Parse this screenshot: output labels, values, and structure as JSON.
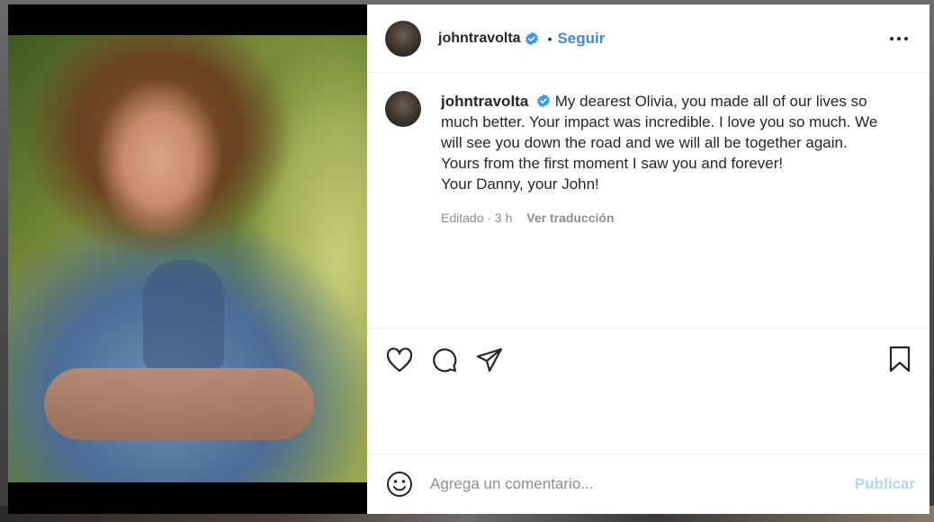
{
  "post": {
    "username": "johntravolta",
    "dot": "•",
    "follow_label": "Seguir",
    "caption_username": "johntravolta",
    "caption_text": "My dearest Olivia, you made all of our lives so much better. Your impact was incredible. I love you so much. We will see you down the road and we will all be together again.",
    "caption_line2": "Yours from the first moment I saw you and forever!",
    "caption_line3": "Your Danny, your John!",
    "edited_time": "Editado · 3 h",
    "translate_label": "Ver traducción"
  },
  "comment_box": {
    "placeholder": "Agrega un comentario...",
    "publish_label": "Publicar"
  },
  "icons": {
    "verified": "verified-badge-icon",
    "more": "more-options-icon",
    "like": "heart-icon",
    "comment": "comment-icon",
    "share": "share-icon",
    "save": "bookmark-icon",
    "emoji": "emoji-icon"
  },
  "colors": {
    "accent": "#3c8ad9",
    "publish_disabled": "#b3d6f5",
    "verified": "#3897f0"
  }
}
